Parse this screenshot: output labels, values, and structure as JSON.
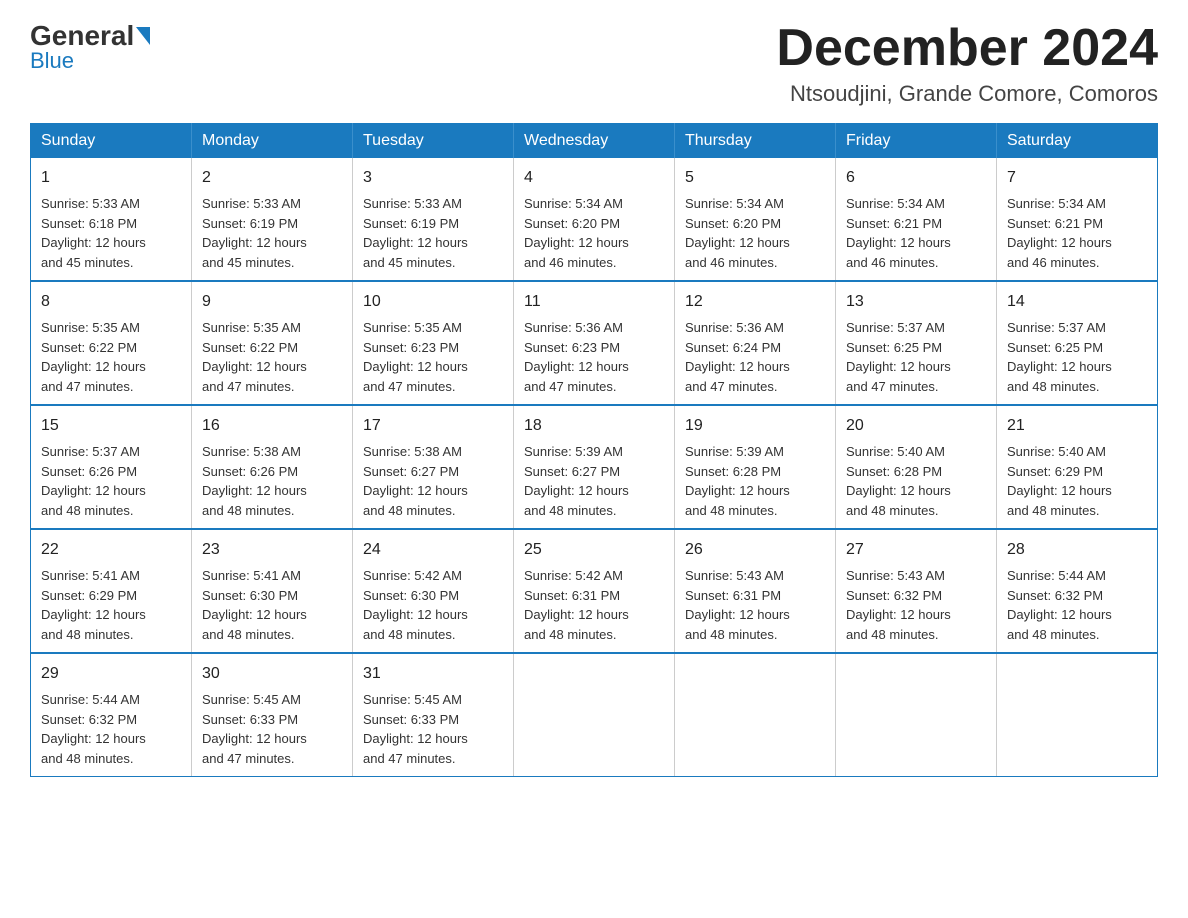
{
  "logo": {
    "name_part1": "General",
    "name_part2": "Blue"
  },
  "header": {
    "month_year": "December 2024",
    "location": "Ntsoudjini, Grande Comore, Comoros"
  },
  "days_of_week": [
    "Sunday",
    "Monday",
    "Tuesday",
    "Wednesday",
    "Thursday",
    "Friday",
    "Saturday"
  ],
  "weeks": [
    [
      {
        "day": "1",
        "sunrise": "5:33 AM",
        "sunset": "6:18 PM",
        "daylight": "12 hours and 45 minutes."
      },
      {
        "day": "2",
        "sunrise": "5:33 AM",
        "sunset": "6:19 PM",
        "daylight": "12 hours and 45 minutes."
      },
      {
        "day": "3",
        "sunrise": "5:33 AM",
        "sunset": "6:19 PM",
        "daylight": "12 hours and 45 minutes."
      },
      {
        "day": "4",
        "sunrise": "5:34 AM",
        "sunset": "6:20 PM",
        "daylight": "12 hours and 46 minutes."
      },
      {
        "day": "5",
        "sunrise": "5:34 AM",
        "sunset": "6:20 PM",
        "daylight": "12 hours and 46 minutes."
      },
      {
        "day": "6",
        "sunrise": "5:34 AM",
        "sunset": "6:21 PM",
        "daylight": "12 hours and 46 minutes."
      },
      {
        "day": "7",
        "sunrise": "5:34 AM",
        "sunset": "6:21 PM",
        "daylight": "12 hours and 46 minutes."
      }
    ],
    [
      {
        "day": "8",
        "sunrise": "5:35 AM",
        "sunset": "6:22 PM",
        "daylight": "12 hours and 47 minutes."
      },
      {
        "day": "9",
        "sunrise": "5:35 AM",
        "sunset": "6:22 PM",
        "daylight": "12 hours and 47 minutes."
      },
      {
        "day": "10",
        "sunrise": "5:35 AM",
        "sunset": "6:23 PM",
        "daylight": "12 hours and 47 minutes."
      },
      {
        "day": "11",
        "sunrise": "5:36 AM",
        "sunset": "6:23 PM",
        "daylight": "12 hours and 47 minutes."
      },
      {
        "day": "12",
        "sunrise": "5:36 AM",
        "sunset": "6:24 PM",
        "daylight": "12 hours and 47 minutes."
      },
      {
        "day": "13",
        "sunrise": "5:37 AM",
        "sunset": "6:25 PM",
        "daylight": "12 hours and 47 minutes."
      },
      {
        "day": "14",
        "sunrise": "5:37 AM",
        "sunset": "6:25 PM",
        "daylight": "12 hours and 48 minutes."
      }
    ],
    [
      {
        "day": "15",
        "sunrise": "5:37 AM",
        "sunset": "6:26 PM",
        "daylight": "12 hours and 48 minutes."
      },
      {
        "day": "16",
        "sunrise": "5:38 AM",
        "sunset": "6:26 PM",
        "daylight": "12 hours and 48 minutes."
      },
      {
        "day": "17",
        "sunrise": "5:38 AM",
        "sunset": "6:27 PM",
        "daylight": "12 hours and 48 minutes."
      },
      {
        "day": "18",
        "sunrise": "5:39 AM",
        "sunset": "6:27 PM",
        "daylight": "12 hours and 48 minutes."
      },
      {
        "day": "19",
        "sunrise": "5:39 AM",
        "sunset": "6:28 PM",
        "daylight": "12 hours and 48 minutes."
      },
      {
        "day": "20",
        "sunrise": "5:40 AM",
        "sunset": "6:28 PM",
        "daylight": "12 hours and 48 minutes."
      },
      {
        "day": "21",
        "sunrise": "5:40 AM",
        "sunset": "6:29 PM",
        "daylight": "12 hours and 48 minutes."
      }
    ],
    [
      {
        "day": "22",
        "sunrise": "5:41 AM",
        "sunset": "6:29 PM",
        "daylight": "12 hours and 48 minutes."
      },
      {
        "day": "23",
        "sunrise": "5:41 AM",
        "sunset": "6:30 PM",
        "daylight": "12 hours and 48 minutes."
      },
      {
        "day": "24",
        "sunrise": "5:42 AM",
        "sunset": "6:30 PM",
        "daylight": "12 hours and 48 minutes."
      },
      {
        "day": "25",
        "sunrise": "5:42 AM",
        "sunset": "6:31 PM",
        "daylight": "12 hours and 48 minutes."
      },
      {
        "day": "26",
        "sunrise": "5:43 AM",
        "sunset": "6:31 PM",
        "daylight": "12 hours and 48 minutes."
      },
      {
        "day": "27",
        "sunrise": "5:43 AM",
        "sunset": "6:32 PM",
        "daylight": "12 hours and 48 minutes."
      },
      {
        "day": "28",
        "sunrise": "5:44 AM",
        "sunset": "6:32 PM",
        "daylight": "12 hours and 48 minutes."
      }
    ],
    [
      {
        "day": "29",
        "sunrise": "5:44 AM",
        "sunset": "6:32 PM",
        "daylight": "12 hours and 48 minutes."
      },
      {
        "day": "30",
        "sunrise": "5:45 AM",
        "sunset": "6:33 PM",
        "daylight": "12 hours and 47 minutes."
      },
      {
        "day": "31",
        "sunrise": "5:45 AM",
        "sunset": "6:33 PM",
        "daylight": "12 hours and 47 minutes."
      },
      null,
      null,
      null,
      null
    ]
  ],
  "labels": {
    "sunrise": "Sunrise:",
    "sunset": "Sunset:",
    "daylight": "Daylight:"
  }
}
